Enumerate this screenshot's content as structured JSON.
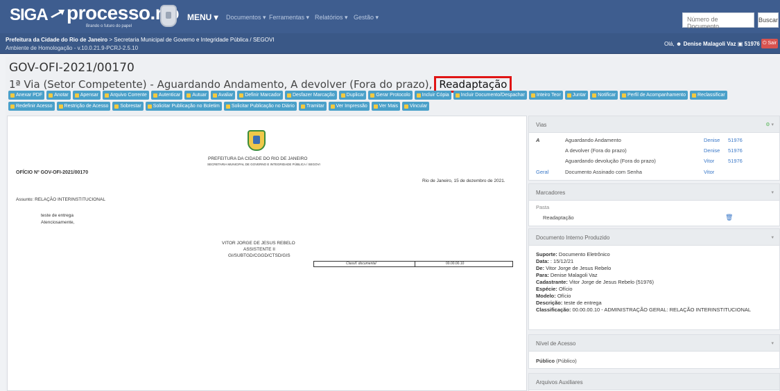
{
  "header": {
    "logo_siga": "SIGA",
    "logo_processo": "processo.rio",
    "tagline": "Brando o futuro do papel",
    "menu_label": "MENU",
    "menu_items": [
      "Documentos",
      "Ferramentas",
      "Relatórios",
      "Gestão"
    ],
    "search_placeholder": "Número de Documento",
    "search_button": "Buscar"
  },
  "infobar": {
    "org_bold": "Prefeitura da Cidade do Rio de Janeiro",
    "org_rest": " > Secretaria Municipal de Governo e Integridade Pública / SEGOVI",
    "environment": "Ambiente de Homologação - v.10.0.21.9-PCRJ-2.5.10",
    "greeting": "Olá,",
    "user_name": "Denise Malagoli Vaz",
    "user_id": "51976",
    "logout": "Sair"
  },
  "document": {
    "title": "GOV-OFI-2021/00170",
    "status": "1ª Via (Setor Competente) - Aguardando Andamento, A devolver (Fora do prazo),",
    "marker": "Readaptação"
  },
  "toolbar": {
    "row1": [
      "Anexar PDF",
      "Anotar",
      "Apensar",
      "Arquivo Corrente",
      "Autenticar",
      "Autuar",
      "Avaliar",
      "Definir Marcador",
      "Desfazer Marcação",
      "Duplicar",
      "Gerar Protocolo",
      "Incluir Cópia",
      "Incluir Documento/Despachar",
      "Inteiro Teor",
      "Juntar",
      "Notificar",
      "Perfil de Acompanhamento",
      "Reclassificar"
    ],
    "row2": [
      "Redefinir Acesso",
      "Restrição de Acesso",
      "Sobrestar",
      "Solicitar Publicação no Boletim",
      "Solicitar Publicação no Diário",
      "Tramitar",
      "Ver Impressão",
      "Ver Mais",
      "Vincular"
    ]
  },
  "preview": {
    "org": "PREFEITURA DA CIDADE DO RIO DE JANEIRO",
    "sub_org": "SECRETARIA MUNICIPAL DE GOVERNO E INTEGRIDADE PÚBLICA / SEGOVI",
    "oficio": "OFÍCIO Nº GOV-OFI-2021/00170",
    "date_line": "Rio de Janeiro, 15 de dezembro de 2021.",
    "subject": "Assunto: RELAÇÃO INTERINSTITUCIONAL",
    "body1": "teste de entrega",
    "body2": "Atenciosamente,",
    "signer": "VITOR JORGE DE JESUS REBELO",
    "role": "ASSISTENTE II",
    "unit": "GI/SUBTGD/CGGD/CTSD/GIS",
    "class_label": "Classif. documental",
    "class_code": "00.00.00.10"
  },
  "vias": {
    "header": "Vias",
    "via_letter": "A",
    "rows": [
      {
        "status": "Aguardando Andamento",
        "name": "Denise",
        "id": "51976"
      },
      {
        "status": "A devolver (Fora do prazo)",
        "name": "Denise",
        "id": "51976"
      },
      {
        "status": "Aguardando devolução (Fora do prazo)",
        "name": "Vitor",
        "id": "51976"
      }
    ],
    "geral_label": "Geral",
    "geral_status": "Documento Assinado com Senha",
    "geral_name": "Vitor"
  },
  "marcadores": {
    "header": "Marcadores",
    "pasta": "Pasta",
    "item": "Readaptação"
  },
  "doc_info": {
    "header": "Documento Interno Produzido",
    "fields": [
      {
        "k": "Suporte:",
        "v": " Documento Eletrônico"
      },
      {
        "k": "Data:",
        "v": " : 15/12/21"
      },
      {
        "k": "De:",
        "v": " Vitor Jorge de Jesus Rebelo"
      },
      {
        "k": "Para:",
        "v": " Denise Malagoli Vaz"
      },
      {
        "k": "Cadastrante:",
        "v": " Vitor Jorge de Jesus Rebelo (51976)"
      },
      {
        "k": "Espécie:",
        "v": " Ofício"
      },
      {
        "k": "Modelo:",
        "v": " Ofício"
      },
      {
        "k": "Descrição:",
        "v": " teste de entrega"
      },
      {
        "k": "Classificação:",
        "v": " 00.00.00.10 - ADMINISTRAÇÃO GERAL: RELAÇÃO INTERINSTITUCIONAL"
      }
    ]
  },
  "acesso": {
    "header": "Nível de Acesso",
    "value_bold": "Público",
    "value_rest": " (Público)"
  },
  "auxiliares": {
    "header": "Arquivos Auxiliares"
  }
}
